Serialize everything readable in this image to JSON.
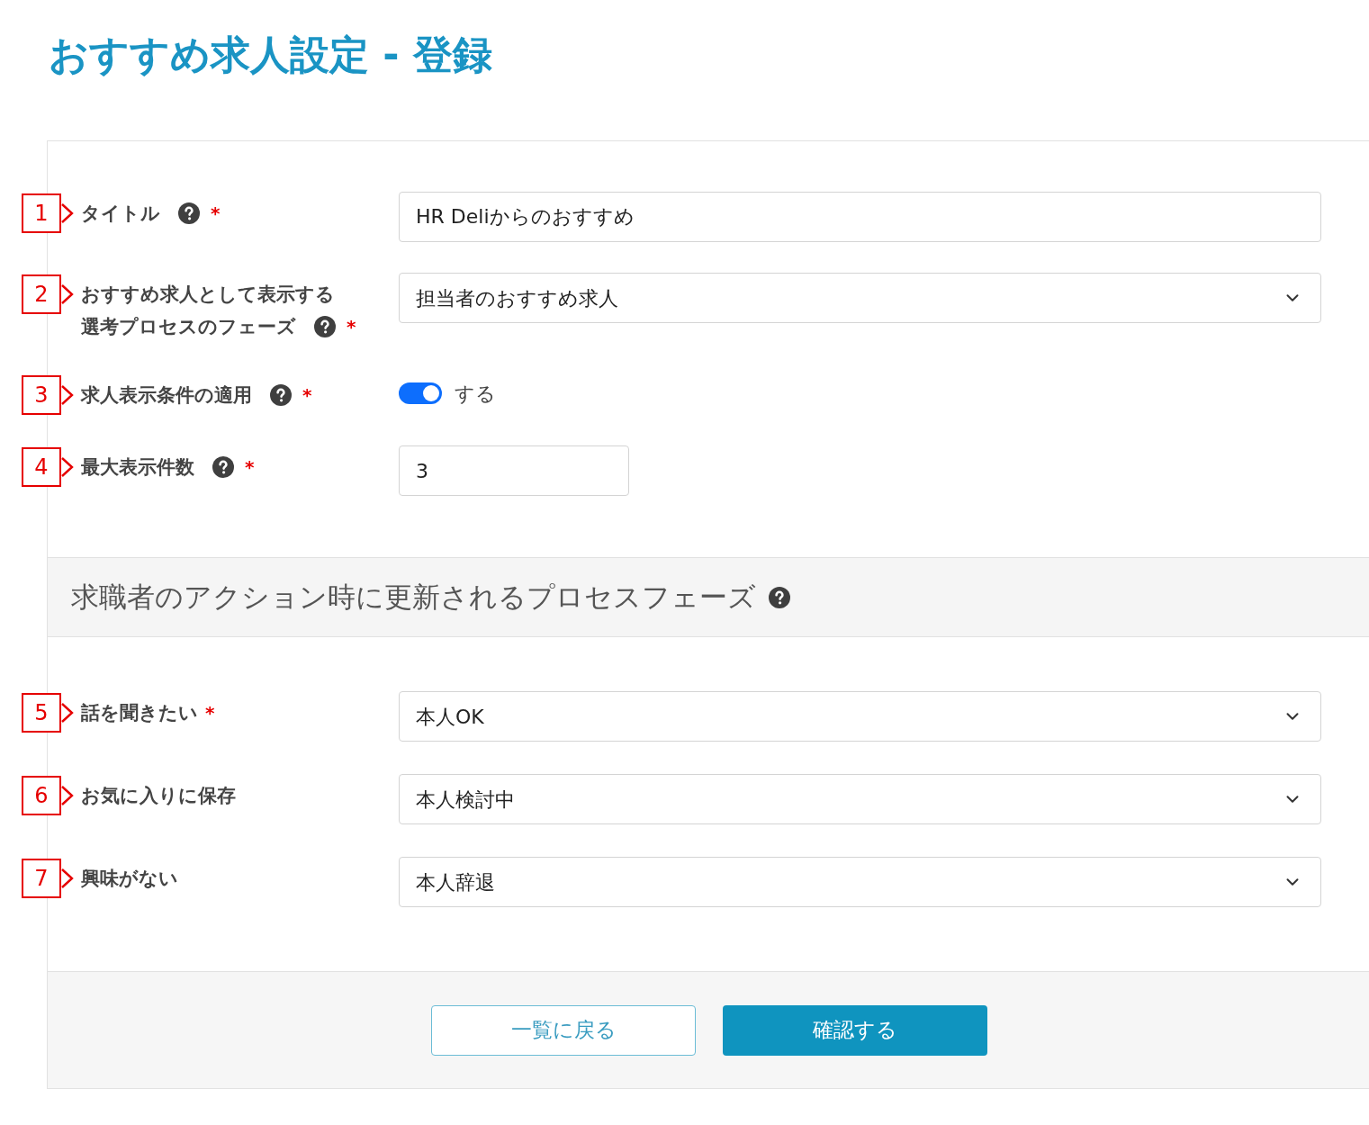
{
  "title": "おすすめ求人設定 - 登録",
  "fields": [
    {
      "number": "1",
      "label": "タイトル",
      "help": true,
      "required_mark": "*",
      "kind": "text",
      "value": "HR Deliからのおすすめ"
    },
    {
      "number": "2",
      "label_lines": [
        "おすすめ求人として表示する",
        "選考プロセスのフェーズ"
      ],
      "help": true,
      "required_mark": "*",
      "kind": "select",
      "value": "担当者のおすすめ求人"
    },
    {
      "number": "3",
      "label": "求人表示条件の適用",
      "help": true,
      "required_mark": "*",
      "kind": "toggle",
      "on": true,
      "value": "する"
    },
    {
      "number": "4",
      "label": "最大表示件数",
      "help": true,
      "required_mark": "*",
      "kind": "short",
      "value": "3"
    }
  ],
  "section": {
    "title": "求職者のアクション時に更新されるプロセスフェーズ",
    "help": true,
    "fields": [
      {
        "number": "5",
        "label": "話を聞きたい",
        "help": false,
        "required_mark": "*",
        "kind": "select",
        "value": "本人OK"
      },
      {
        "number": "6",
        "label": "お気に入りに保存",
        "help": false,
        "kind": "select",
        "value": "本人検討中"
      },
      {
        "number": "7",
        "label": "興味がない",
        "help": false,
        "kind": "select",
        "value": "本人辞退"
      }
    ]
  },
  "buttons": [
    {
      "label": "一覧に戻る",
      "kind": "secondary"
    },
    {
      "label": "確認する",
      "kind": "primary"
    }
  ]
}
